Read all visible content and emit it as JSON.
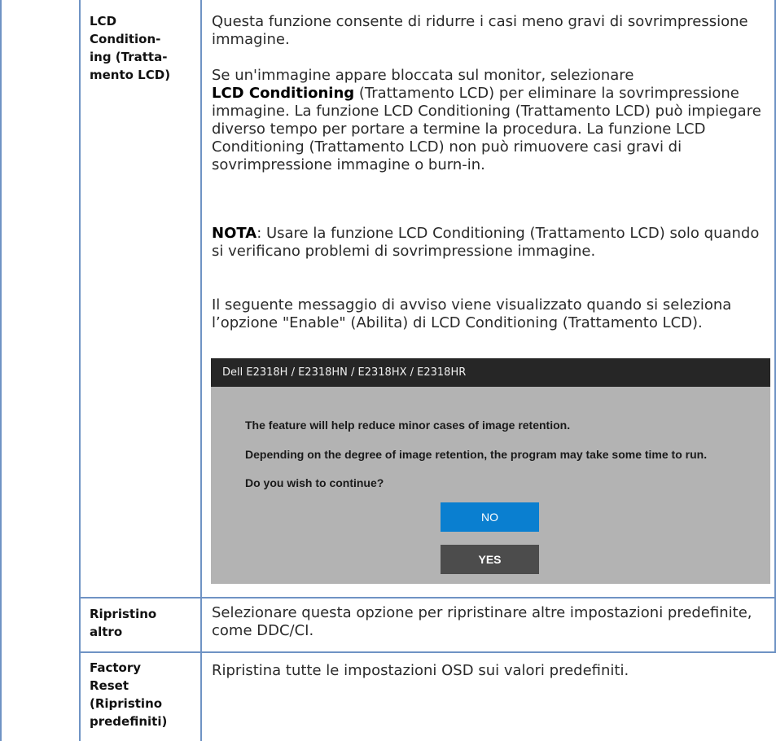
{
  "rows": [
    {
      "name_lines": [
        "LCD",
        "Condition-",
        "ing (Tratta-",
        "mento LCD)"
      ],
      "paragraphs": [
        "Questa funzione consente di ridurre i casi meno gravi di sovrimpressione immagine.",
        "Se un'immagine appare bloccata sul monitor, selezionare",
        "(Trattamento LCD) per eliminare la sovrimpressione immagine. La funzione LCD Conditioning (Trattamento LCD) può impiegare diverso tempo per portare a termine la procedura. La funzione LCD Conditioning (Trattamento LCD) non può rimuovere casi gravi di sovrimpressione immagine o burn-in.",
        ": Usare la funzione LCD Conditioning (Trattamento LCD) solo quando si verificano problemi di sovrimpressione immagine.",
        "Il seguente messaggio di avviso viene visualizzato quando si seleziona l’opzione \"Enable\" (Abilita) di LCD Conditioning (Trattamento LCD)."
      ],
      "bold_terms": {
        "lcd_conditioning": "LCD Conditioning",
        "nota": "NOTA"
      },
      "osd": {
        "title": "Dell  E2318H / E2318HN / E2318HX / E2318HR",
        "lines": [
          "The feature will help reduce minor cases of image retention.",
          "Depending on the degree of image retention, the program may take some time to run.",
          "Do you wish to continue?"
        ],
        "no_label": "NO",
        "yes_label": "YES",
        "colors": {
          "panel": "#b3b3b3",
          "titlebar": "#262626",
          "no": "#0a7fd0",
          "yes": "#4c4c4c"
        }
      }
    },
    {
      "name_lines": [
        "Ripristino",
        "altro"
      ],
      "description": "Selezionare questa opzione per ripristinare altre impostazioni predefinite, come DDC/CI."
    },
    {
      "name_lines": [
        "Factory",
        "Reset",
        "(Ripristino",
        "predefiniti)"
      ],
      "description": "Ripristina tutte le impostazioni OSD sui valori predefiniti."
    }
  ],
  "colors": {
    "grid": "#6f93c4",
    "text": "#2a2a2a"
  }
}
